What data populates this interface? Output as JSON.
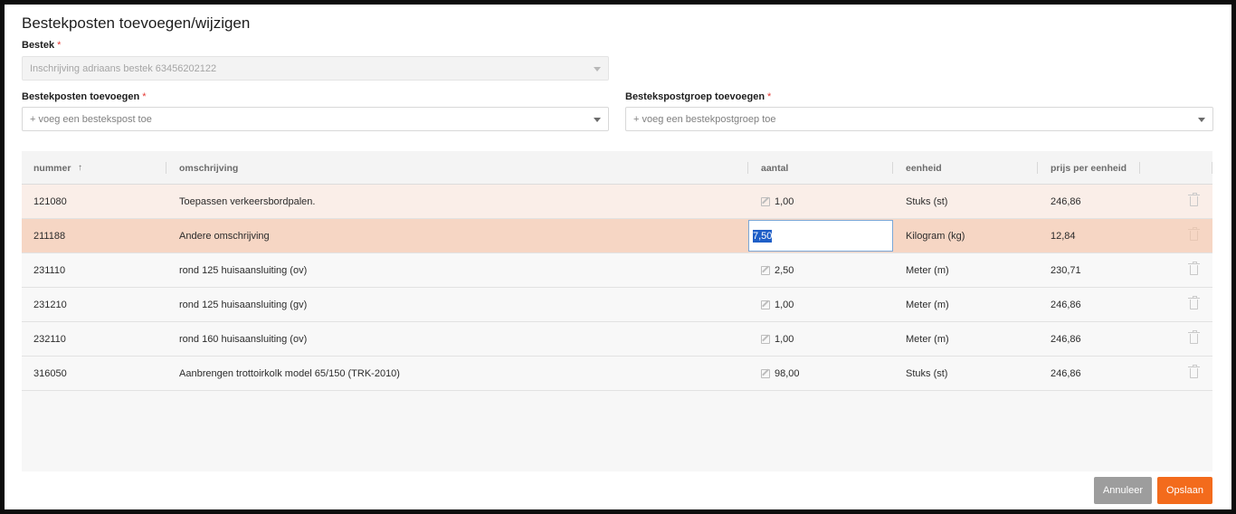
{
  "dialog": {
    "title": "Bestekposten toevoegen/wijzigen"
  },
  "bestek": {
    "label": "Bestek",
    "required_mark": "*",
    "value": "Inschrijving adriaans bestek 63456202122"
  },
  "posten": {
    "label": "Bestekposten toevoegen",
    "required_mark": "*",
    "placeholder": "+ voeg een bestekspost toe"
  },
  "groep": {
    "label": "Bestekspostgroep toevoegen",
    "required_mark": "*",
    "placeholder": "+ voeg een bestekpostgroep toe"
  },
  "table": {
    "columns": {
      "nummer": "nummer",
      "omschrijving": "omschrijving",
      "aantal": "aantal",
      "eenheid": "eenheid",
      "prijs": "prijs per eenheid"
    },
    "sort_icon": "arrow-up-icon",
    "rows": [
      {
        "nummer": "121080",
        "omschrijving": "Toepassen verkeersbordpalen.",
        "aantal": "1,00",
        "eenheid": "Stuks (st)",
        "prijs": "246,86"
      },
      {
        "nummer": "211188",
        "omschrijving": "Andere omschrijving",
        "aantal": "7,50",
        "eenheid": "Kilogram (kg)",
        "prijs": "12,84"
      },
      {
        "nummer": "231110",
        "omschrijving": "rond 125 huisaansluiting (ov)",
        "aantal": "2,50",
        "eenheid": "Meter (m)",
        "prijs": "230,71"
      },
      {
        "nummer": "231210",
        "omschrijving": "rond 125 huisaansluiting (gv)",
        "aantal": "1,00",
        "eenheid": "Meter (m)",
        "prijs": "246,86"
      },
      {
        "nummer": "232110",
        "omschrijving": "rond 160 huisaansluiting (ov)",
        "aantal": "1,00",
        "eenheid": "Meter (m)",
        "prijs": "246,86"
      },
      {
        "nummer": "316050",
        "omschrijving": "Aanbrengen trottoirkolk model 65/150 (TRK-2010)",
        "aantal": "98,00",
        "eenheid": "Stuks (st)",
        "prijs": "246,86"
      }
    ]
  },
  "buttons": {
    "cancel": "Annuleer",
    "save": "Opslaan"
  },
  "colors": {
    "accent": "#f36b1c",
    "row_highlight": "#f6d6c4",
    "row_hover": "#faeee8",
    "selection": "#1f5fc7"
  }
}
